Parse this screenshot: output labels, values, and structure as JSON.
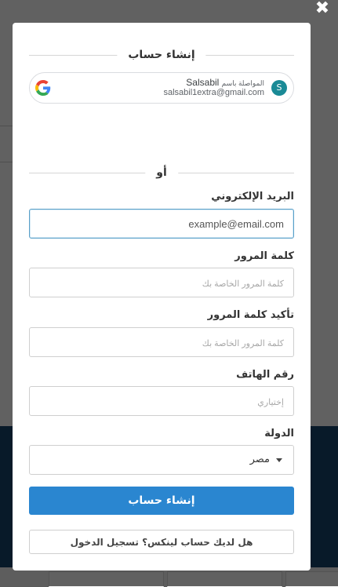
{
  "modal": {
    "title": "إنشاء حساب",
    "google": {
      "avatar_letter": "S",
      "continue_prefix": "المواصلة باسم",
      "name": "Salsabil",
      "email": "salsabil1extra@gmail.com",
      "icon": "google-g-icon"
    },
    "or_label": "أو",
    "fields": {
      "email": {
        "label": "البريد الإلكتروني",
        "placeholder": "example@email.com"
      },
      "password": {
        "label": "كلمة المرور",
        "placeholder": "كلمة المرور الخاصة بك"
      },
      "confirm_password": {
        "label": "تأكيد كلمة المرور",
        "placeholder": "كلمة المرور الخاصة بك"
      },
      "phone": {
        "label": "رقم الهاتف",
        "placeholder": "إختياري"
      },
      "country": {
        "label": "الدولة",
        "value": "مصر"
      }
    },
    "submit_label": "إنشاء حساب",
    "login_label": "هل لديك حساب لينكس؟ تسجيل الدخول"
  },
  "colors": {
    "primary": "#2a86d0",
    "avatar": "#1a8a96",
    "backdrop_hero": "#17456d"
  }
}
